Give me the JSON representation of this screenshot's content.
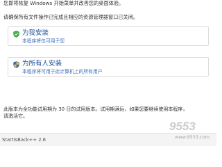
{
  "intro": {
    "line1": "您即将恢复 Windows 开始菜单并改善您的桌面体验。",
    "line2": "请确保所有文件操作已完成且相应的资源管理器窗口已关闭。"
  },
  "options": [
    {
      "title": "为我安装",
      "subtitle": "本程序将仅可用于您",
      "icon": "shield-icon"
    },
    {
      "title": "为所有人安装",
      "subtitle": "本程序将可用于此计算机上的所有用户",
      "icon": "uac-shield-icon"
    }
  ],
  "notice": {
    "line1": "此版本为全功能试用期为 30 日的试用版本。试用期满后，如果您要继续使用本程序，",
    "line2": "请激活它。"
  },
  "footer": {
    "version": "StartIsBack++ 2.6"
  },
  "watermark": {
    "main": "9553",
    "sub": "www.9553.com"
  },
  "colors": {
    "option_title": "#1a4f96",
    "option_subtitle": "#3a6db8",
    "shield_green": "#4caf50",
    "uac_blue": "#2f6fc6",
    "uac_yellow": "#f2c230"
  }
}
